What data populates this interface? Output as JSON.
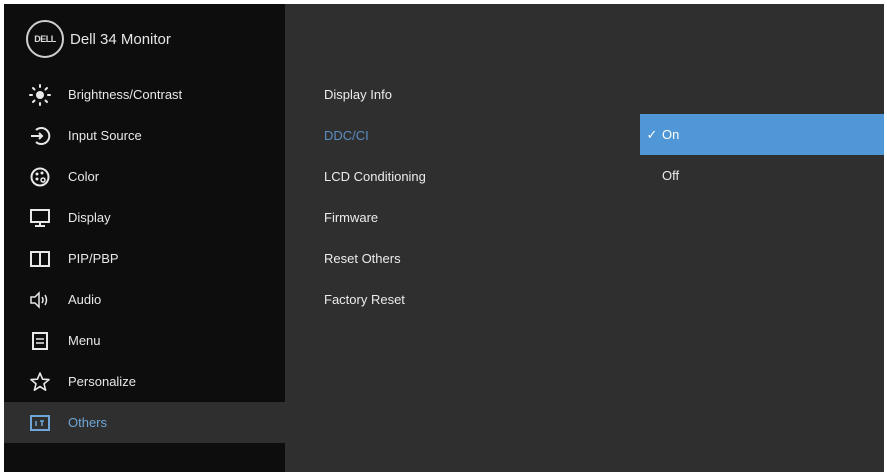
{
  "brand": {
    "logo_text": "DELL",
    "title": "Dell 34 Monitor"
  },
  "menu": {
    "items": [
      {
        "label": "Brightness/Contrast",
        "icon": "brightness-icon"
      },
      {
        "label": "Input Source",
        "icon": "input-source-icon"
      },
      {
        "label": "Color",
        "icon": "color-palette-icon"
      },
      {
        "label": "Display",
        "icon": "display-icon"
      },
      {
        "label": "PIP/PBP",
        "icon": "pip-pbp-icon"
      },
      {
        "label": "Audio",
        "icon": "speaker-icon"
      },
      {
        "label": "Menu",
        "icon": "menu-icon"
      },
      {
        "label": "Personalize",
        "icon": "star-icon"
      },
      {
        "label": "Others",
        "icon": "others-icon",
        "active": true
      }
    ]
  },
  "submenu": {
    "items": [
      {
        "label": "Display Info"
      },
      {
        "label": "DDC/CI",
        "active": true
      },
      {
        "label": "LCD Conditioning"
      },
      {
        "label": "Firmware"
      },
      {
        "label": "Reset Others"
      },
      {
        "label": "Factory Reset"
      }
    ]
  },
  "options": {
    "check_mark": "✓",
    "items": [
      {
        "label": "On",
        "selected": true
      },
      {
        "label": "Off",
        "selected": false
      }
    ]
  },
  "colors": {
    "background": "#2f2f2f",
    "sidebar": "#0d0d0d",
    "highlight": "#4f97d6",
    "active_text": "#6ea6d8"
  }
}
